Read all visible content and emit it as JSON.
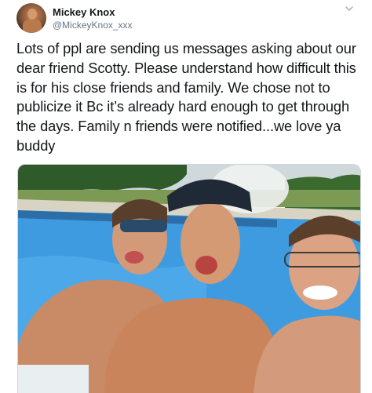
{
  "tweet": {
    "author": {
      "display_name": "Mickey Knox",
      "handle": "@MickeyKnox_xxx",
      "avatar_icon": "profile-photo"
    },
    "text": "Lots of ppl are sending us messages asking about our\ndear friend Scotty.  Please understand how difficult this\nis for his close friends and family.  We chose not to\npublicize it Bc it’s already hard enough to get through\nthe days. Family n friends were notified...we love ya\nbuddy",
    "menu_icon": "chevron-down-icon",
    "media": {
      "type": "photo",
      "icon": "photo-icon"
    }
  },
  "colors": {
    "text_primary": "#14171a",
    "text_secondary": "#657786",
    "divider": "#ccd6dd",
    "pool_water": "#3f9be0"
  }
}
